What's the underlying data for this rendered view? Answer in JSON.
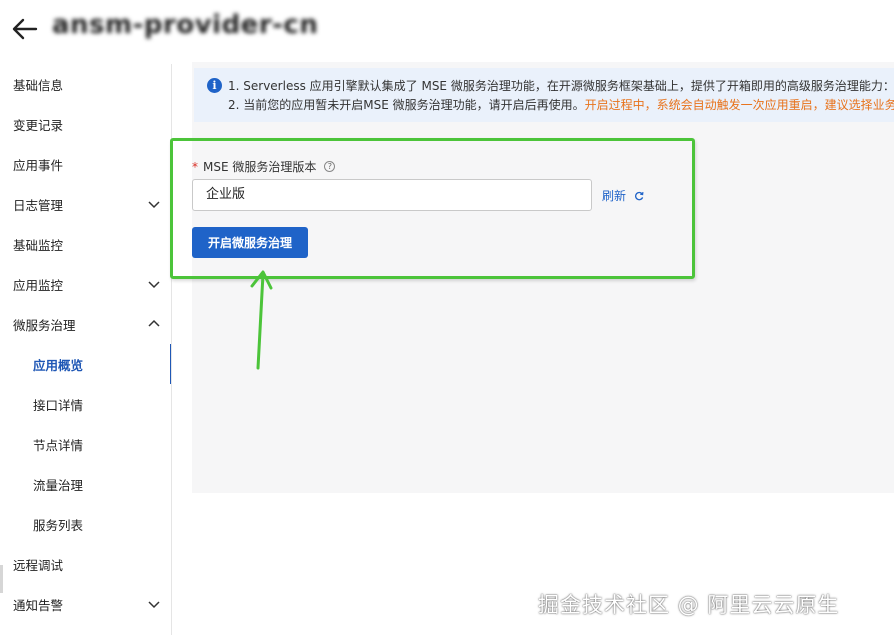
{
  "header": {
    "title": "ansm-provider-cn"
  },
  "sidebar": {
    "items": [
      {
        "label": "基础信息"
      },
      {
        "label": "变更记录"
      },
      {
        "label": "应用事件"
      },
      {
        "label": "日志管理",
        "expandable": true,
        "expanded": false
      },
      {
        "label": "基础监控"
      },
      {
        "label": "应用监控",
        "expandable": true,
        "expanded": false
      },
      {
        "label": "微服务治理",
        "expandable": true,
        "expanded": true
      },
      {
        "label": "应用概览",
        "child": true,
        "active": true
      },
      {
        "label": "接口详情",
        "child": true
      },
      {
        "label": "节点详情",
        "child": true
      },
      {
        "label": "流量治理",
        "child": true
      },
      {
        "label": "服务列表",
        "child": true
      },
      {
        "label": "远程调试"
      },
      {
        "label": "通知告警",
        "expandable": true,
        "expanded": false
      }
    ]
  },
  "notice": {
    "icon": "info-icon",
    "line1": "1. Serverless 应用引擎默认集成了 MSE 微服务治理功能，在开源微服务框架基础上，提供了开箱即用的高级服务治理能力：如",
    "line2_text": "2. 当前您的应用暂未开启MSE 微服务治理功能，请开启后再使用。",
    "line2_warning": "开启过程中，系统会自动触发一次应用重启，建议选择业务"
  },
  "form": {
    "required_mark": "*",
    "field_label": "MSE 微服务治理版本",
    "help_icon": "?",
    "version_value": "企业版",
    "refresh_label": "刷新",
    "enable_button": "开启微服务治理"
  },
  "watermark": "掘金技术社区 @ 阿里云云原生",
  "colors": {
    "primary": "#1f63c8",
    "annotation": "#4cc43a",
    "warning": "#e8731c",
    "notice_bg": "#eaf1fb"
  }
}
